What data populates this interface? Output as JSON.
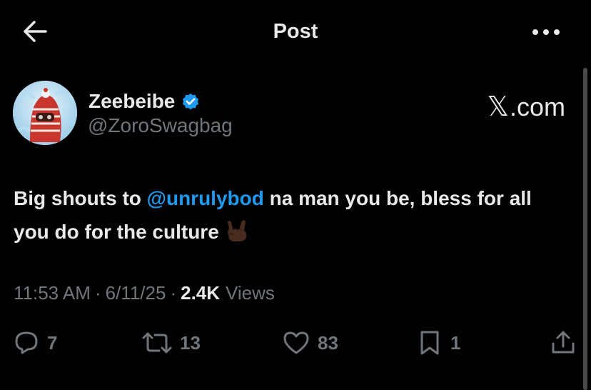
{
  "header": {
    "title": "Post",
    "back_icon": "arrow-left-icon",
    "more_icon": "more-horizontal-icon"
  },
  "author": {
    "display_name": "Zeebeibe",
    "handle": "@ZoroSwagbag",
    "verified_icon": "verified-badge-icon",
    "verified_color": "#1d9bf0"
  },
  "site_label": {
    "x_glyph": "𝕏",
    "suffix": ".com"
  },
  "tweet": {
    "text_before": "Big shouts to ",
    "mention": "@unrulybod",
    "text_after": " na man you be, bless for all you do for the culture",
    "emoji": "sign-of-the-horns-emoji"
  },
  "meta": {
    "time": "11:53 AM",
    "separator": "·",
    "date": "6/11/25",
    "views_count": "2.4K",
    "views_label": "Views"
  },
  "actions": {
    "replies": "7",
    "reposts": "13",
    "likes": "83",
    "bookmarks": "1"
  },
  "colors": {
    "background": "#000000",
    "text": "#e7e9ea",
    "secondary": "#71767b",
    "accent": "#1d9bf0"
  }
}
